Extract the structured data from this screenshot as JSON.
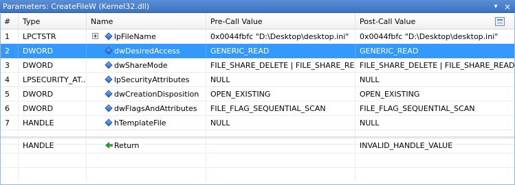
{
  "window": {
    "title": "Parameters: CreateFileW (Kernel32.dll)",
    "pin_glyph": "▾",
    "close_glyph": "×"
  },
  "columns": {
    "num": "#",
    "type": "Type",
    "name": "Name",
    "pre": "Pre-Call Value",
    "post": "Post-Call Value"
  },
  "rows": [
    {
      "num": "1",
      "type": "LPCTSTR",
      "name": "lpFileName",
      "pre": "0x0044fbfc \"D:\\Desktop\\desktop.ini\"",
      "post": "0x0044fbfc \"D:\\Desktop\\desktop.ini\"",
      "expandable": true
    },
    {
      "num": "2",
      "type": "DWORD",
      "name": "dwDesiredAccess",
      "pre": "GENERIC_READ",
      "post": "GENERIC_READ",
      "selected": true
    },
    {
      "num": "3",
      "type": "DWORD",
      "name": "dwShareMode",
      "pre": "FILE_SHARE_DELETE | FILE_SHARE_READ",
      "post": "FILE_SHARE_DELETE | FILE_SHARE_READ"
    },
    {
      "num": "4",
      "type": "LPSECURITY_AT...",
      "name": "lpSecurityAttributes",
      "pre": "NULL",
      "post": "NULL"
    },
    {
      "num": "5",
      "type": "DWORD",
      "name": "dwCreationDisposition",
      "pre": "OPEN_EXISTING",
      "post": "OPEN_EXISTING"
    },
    {
      "num": "6",
      "type": "DWORD",
      "name": "dwFlagsAndAttributes",
      "pre": "FILE_FLAG_SEQUENTIAL_SCAN",
      "post": "FILE_FLAG_SEQUENTIAL_SCAN"
    },
    {
      "num": "7",
      "type": "HANDLE",
      "name": "hTemplateFile",
      "pre": "NULL",
      "post": "NULL"
    }
  ],
  "return_row": {
    "type": "HANDLE",
    "name": "Return",
    "pre": "",
    "post": "INVALID_HANDLE_VALUE"
  },
  "colors": {
    "selection": "#3399ff",
    "titlebar": "#4a82cc"
  }
}
